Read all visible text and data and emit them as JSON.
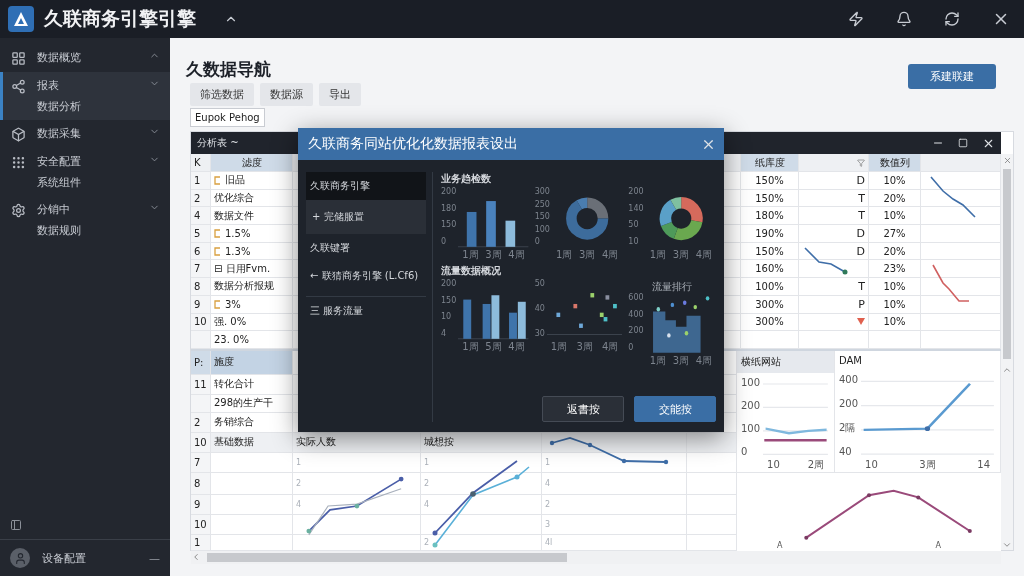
{
  "app": {
    "title": "久联商务引擎引擎"
  },
  "sidebar": {
    "items": [
      {
        "kind": "grid",
        "lines": [
          "数据概览"
        ],
        "selected": false,
        "expanded": true
      },
      {
        "kind": "network",
        "lines": [
          "报表",
          "数据分析"
        ],
        "selected": true,
        "expanded": false
      },
      {
        "kind": "box",
        "lines": [
          "数据采集"
        ],
        "selected": false,
        "expanded": false
      },
      {
        "kind": "dots",
        "lines": [
          "安全配置",
          "系统组件"
        ],
        "selected": false,
        "expanded": false
      },
      {
        "kind": "gear",
        "lines": [
          "分销中",
          "数据规则"
        ],
        "selected": false,
        "expanded": false
      }
    ],
    "user": {
      "name": "设备配置",
      "menu": "—"
    }
  },
  "page": {
    "heading": "久数据导航",
    "actions": [
      "筛选数据",
      "数据源",
      "导出"
    ],
    "period": "Eupok Pehog",
    "primary": "系建联建"
  },
  "sheet": {
    "title": "分析表 ~",
    "header": {
      "corner": "K",
      "col_a": "滤度",
      "col_d": "纸库度",
      "col_f": "数值列"
    },
    "rows": [
      {
        "n": "1",
        "label": "旧品",
        "flag": true
      },
      {
        "n": "2",
        "label": "优化综合",
        "flag": false
      },
      {
        "n": "4",
        "label": "数据文件",
        "flag": false
      },
      {
        "n": "5",
        "label": "1.5%",
        "flag": true
      },
      {
        "n": "6",
        "label": "1.3%",
        "flag": true
      },
      {
        "n": "7",
        "label": "⊟ 日用Fvm.",
        "flag": false
      },
      {
        "n": "8",
        "label": "数据分析报规",
        "flag": false
      },
      {
        "n": "9",
        "label": "3%",
        "flag": true
      },
      {
        "n": "10",
        "label": "强.    0%",
        "flag": false
      },
      {
        "label": "23.    0%",
        "flag": false
      }
    ],
    "right_rows": [
      {
        "pct": "150%",
        "code": "D",
        "alert": false,
        "val": "10%"
      },
      {
        "pct": "150%",
        "code": "T",
        "alert": false,
        "val": "20%"
      },
      {
        "pct": "180%",
        "code": "T",
        "alert": false,
        "val": "10%"
      },
      {
        "pct": "190%",
        "code": "D",
        "alert": false,
        "val": "27%"
      },
      {
        "pct": "150%",
        "code": "D",
        "alert": false,
        "val": "20%"
      },
      {
        "pct": "160%",
        "alert": false,
        "val": "23%"
      },
      {
        "pct": "100%",
        "code": "T",
        "alert": false,
        "val": "10%"
      },
      {
        "pct": "300%",
        "code": "P",
        "alert": false,
        "val": "10%"
      },
      {
        "pct": "300%",
        "alert": true,
        "val": "10%"
      }
    ],
    "lower_rows": [
      {
        "n": "P:",
        "label": "施度",
        "selected": true
      },
      {
        "n": "11",
        "label": "转化合计",
        "selected": false
      },
      {
        "label": "298的生产干",
        "selected": false
      },
      {
        "n": "2",
        "label": "务销综合",
        "selected": false
      },
      {
        "n": "10",
        "label": "基础数据",
        "selected": false
      },
      {
        "n": "7",
        "selected": false
      },
      {
        "n": "8",
        "selected": false
      },
      {
        "n": "9",
        "selected": false
      },
      {
        "n": "10",
        "selected": false
      },
      {
        "n": "1",
        "selected": false
      }
    ],
    "col_b": {
      "heading": "实际人数",
      "ticks": [
        "1",
        "2",
        "4"
      ]
    },
    "col_c": {
      "heading": "城想按",
      "ticks": [
        "1",
        "2",
        "4"
      ],
      "last_tick": "2"
    },
    "col_d": {
      "ticks": [
        "1",
        "4",
        "2",
        "3",
        "4l"
      ]
    },
    "panels": [
      {
        "title": "横纸网站",
        "yticks": [
          "100",
          "200",
          "100",
          "0"
        ],
        "xticks": [
          "10",
          "2周"
        ]
      },
      {
        "title": "DAM",
        "yticks": [
          "400",
          "200",
          "2隔",
          "40"
        ],
        "xticks": [
          "10",
          "3周",
          "14"
        ]
      }
    ],
    "trend": {
      "xticks": [
        "A",
        "A"
      ]
    }
  },
  "dialog": {
    "title": "久联商务同站优化化数据报表设出",
    "nav": [
      {
        "kind": "item",
        "label": "久联商务引擎",
        "selected": true
      },
      {
        "kind": "group",
        "label": "+ 完储服置",
        "selected": false
      },
      {
        "kind": "item",
        "label": "久联键署",
        "selected": false
      },
      {
        "kind": "item",
        "label": "← 联猜商务引擎 (L.Cf6)",
        "selected": false
      },
      {
        "kind": "section",
        "label": "三 服务流量",
        "selected": false
      }
    ],
    "sections": [
      {
        "title": "业务趋检数",
        "charts": [
          {
            "kind": "bar",
            "yticks": [
              "200",
              "180",
              "150",
              "0"
            ],
            "xticks": [
              "1周",
              "3周",
              "4周"
            ]
          },
          {
            "kind": "donut",
            "yticks": [
              "300",
              "250",
              "150",
              "100",
              "0"
            ],
            "xticks": [
              "1周",
              "3周",
              "4周"
            ]
          },
          {
            "kind": "pie",
            "yticks": [
              "200",
              "140",
              "50",
              "10"
            ],
            "xticks": [
              "1周",
              "3周",
              "4周"
            ]
          }
        ]
      },
      {
        "title": "流量数据概况",
        "charts": [
          {
            "kind": "grouped",
            "yticks": [
              "200",
              "150",
              "10",
              "4"
            ],
            "xticks": [
              "1周",
              "5周",
              "4周"
            ]
          },
          {
            "kind": "scatter",
            "yticks": [
              "50",
              "40",
              "30"
            ],
            "xticks": [
              "1周",
              "3周",
              "4周"
            ]
          },
          {
            "kind": "area",
            "title": "流量排行",
            "yticks": [
              "600",
              "400",
              "200",
              "0"
            ],
            "xticks": [
              "1周",
              "3周",
              "4周"
            ]
          }
        ]
      }
    ],
    "buttons": [
      {
        "label": "返書按",
        "primary": false
      },
      {
        "label": "交能按",
        "primary": true
      }
    ]
  }
}
